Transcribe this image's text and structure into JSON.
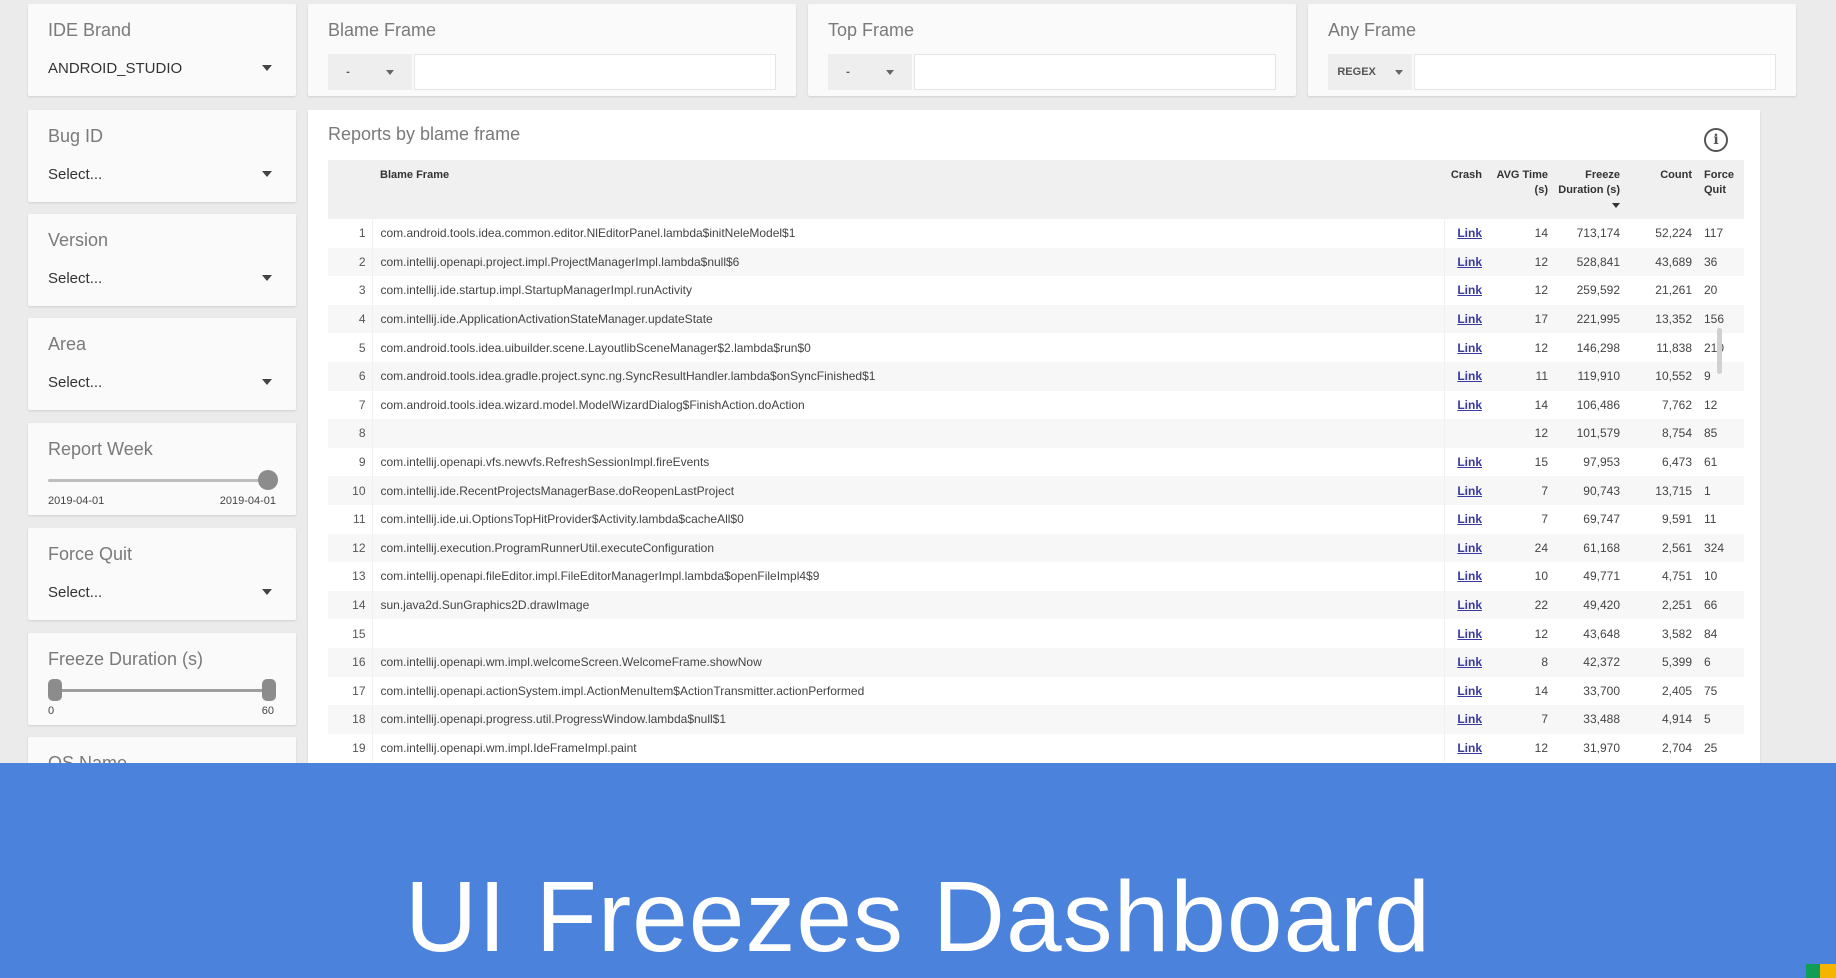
{
  "filters": {
    "ide_brand": {
      "label": "IDE Brand",
      "value": "ANDROID_STUDIO"
    },
    "bug_id": {
      "label": "Bug ID",
      "value": "Select..."
    },
    "version": {
      "label": "Version",
      "value": "Select..."
    },
    "area": {
      "label": "Area",
      "value": "Select..."
    },
    "report_week": {
      "label": "Report Week",
      "min_label": "2019-04-01",
      "max_label": "2019-04-01"
    },
    "force_quit": {
      "label": "Force Quit",
      "value": "Select..."
    },
    "freeze_duration": {
      "label": "Freeze Duration (s)",
      "min_label": "0",
      "max_label": "60"
    },
    "os_name": {
      "label": "OS Name"
    }
  },
  "frame_filters": {
    "blame": {
      "label": "Blame Frame",
      "mode": "-",
      "value": ""
    },
    "top": {
      "label": "Top Frame",
      "mode": "-",
      "value": ""
    },
    "any": {
      "label": "Any Frame",
      "mode": "REGEX",
      "value": ""
    }
  },
  "table": {
    "title": "Reports by blame frame",
    "headers": {
      "frame": "Blame Frame",
      "crash": "Crash",
      "avg_time": "AVG Time (s)",
      "freeze_duration": "Freeze Duration (s)",
      "count": "Count",
      "force_quit": "Force Quit"
    },
    "rows": [
      {
        "idx": "1",
        "frame": "com.android.tools.idea.common.editor.NlEditorPanel.lambda$initNeleModel$1",
        "crash": "Link",
        "avg": "14",
        "dur": "713,174",
        "count": "52,224",
        "fq": "117"
      },
      {
        "idx": "2",
        "frame": "com.intellij.openapi.project.impl.ProjectManagerImpl.lambda$null$6",
        "crash": "Link",
        "avg": "12",
        "dur": "528,841",
        "count": "43,689",
        "fq": "36"
      },
      {
        "idx": "3",
        "frame": "com.intellij.ide.startup.impl.StartupManagerImpl.runActivity",
        "crash": "Link",
        "avg": "12",
        "dur": "259,592",
        "count": "21,261",
        "fq": "20"
      },
      {
        "idx": "4",
        "frame": "com.intellij.ide.ApplicationActivationStateManager.updateState",
        "crash": "Link",
        "avg": "17",
        "dur": "221,995",
        "count": "13,352",
        "fq": "156"
      },
      {
        "idx": "5",
        "frame": "com.android.tools.idea.uibuilder.scene.LayoutlibSceneManager$2.lambda$run$0",
        "crash": "Link",
        "avg": "12",
        "dur": "146,298",
        "count": "11,838",
        "fq": "210"
      },
      {
        "idx": "6",
        "frame": "com.android.tools.idea.gradle.project.sync.ng.SyncResultHandler.lambda$onSyncFinished$1",
        "crash": "Link",
        "avg": "11",
        "dur": "119,910",
        "count": "10,552",
        "fq": "9"
      },
      {
        "idx": "7",
        "frame": "com.android.tools.idea.wizard.model.ModelWizardDialog$FinishAction.doAction",
        "crash": "Link",
        "avg": "14",
        "dur": "106,486",
        "count": "7,762",
        "fq": "12"
      },
      {
        "idx": "8",
        "frame": "",
        "crash": "",
        "avg": "12",
        "dur": "101,579",
        "count": "8,754",
        "fq": "85"
      },
      {
        "idx": "9",
        "frame": "com.intellij.openapi.vfs.newvfs.RefreshSessionImpl.fireEvents",
        "crash": "Link",
        "avg": "15",
        "dur": "97,953",
        "count": "6,473",
        "fq": "61"
      },
      {
        "idx": "10",
        "frame": "com.intellij.ide.RecentProjectsManagerBase.doReopenLastProject",
        "crash": "Link",
        "avg": "7",
        "dur": "90,743",
        "count": "13,715",
        "fq": "1"
      },
      {
        "idx": "11",
        "frame": "com.intellij.ide.ui.OptionsTopHitProvider$Activity.lambda$cacheAll$0",
        "crash": "Link",
        "avg": "7",
        "dur": "69,747",
        "count": "9,591",
        "fq": "11"
      },
      {
        "idx": "12",
        "frame": "com.intellij.execution.ProgramRunnerUtil.executeConfiguration",
        "crash": "Link",
        "avg": "24",
        "dur": "61,168",
        "count": "2,561",
        "fq": "324"
      },
      {
        "idx": "13",
        "frame": "com.intellij.openapi.fileEditor.impl.FileEditorManagerImpl.lambda$openFileImpl4$9",
        "crash": "Link",
        "avg": "10",
        "dur": "49,771",
        "count": "4,751",
        "fq": "10"
      },
      {
        "idx": "14",
        "frame": "sun.java2d.SunGraphics2D.drawImage",
        "crash": "Link",
        "avg": "22",
        "dur": "49,420",
        "count": "2,251",
        "fq": "66"
      },
      {
        "idx": "15",
        "frame": "",
        "crash": "Link",
        "avg": "12",
        "dur": "43,648",
        "count": "3,582",
        "fq": "84"
      },
      {
        "idx": "16",
        "frame": "com.intellij.openapi.wm.impl.welcomeScreen.WelcomeFrame.showNow",
        "crash": "Link",
        "avg": "8",
        "dur": "42,372",
        "count": "5,399",
        "fq": "6"
      },
      {
        "idx": "17",
        "frame": "com.intellij.openapi.actionSystem.impl.ActionMenuItem$ActionTransmitter.actionPerformed",
        "crash": "Link",
        "avg": "14",
        "dur": "33,700",
        "count": "2,405",
        "fq": "75"
      },
      {
        "idx": "18",
        "frame": "com.intellij.openapi.progress.util.ProgressWindow.lambda$null$1",
        "crash": "Link",
        "avg": "7",
        "dur": "33,488",
        "count": "4,914",
        "fq": "5"
      },
      {
        "idx": "19",
        "frame": "com.intellij.openapi.wm.impl.IdeFrameImpl.paint",
        "crash": "Link",
        "avg": "12",
        "dur": "31,970",
        "count": "2,704",
        "fq": "25"
      }
    ]
  },
  "banner": {
    "title": "UI Freezes Dashboard"
  },
  "colors": {
    "banner": "#4b83dc",
    "link": "#3a3aa0",
    "background": "#ebebeb"
  }
}
